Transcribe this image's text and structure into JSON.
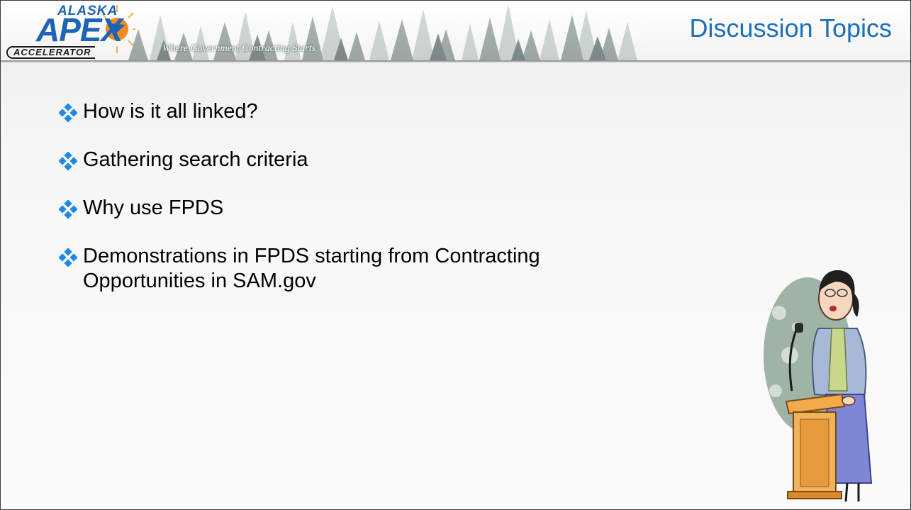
{
  "header": {
    "logo": {
      "top": "ALASKA",
      "main": "APEX",
      "bottom": "ACCELERATOR"
    },
    "tagline": "Where Government Contracting Starts",
    "title": "Discussion Topics"
  },
  "bullets": [
    {
      "text": "How is it all linked?"
    },
    {
      "text": "Gathering search criteria"
    },
    {
      "text": "Why use FPDS"
    },
    {
      "text": "Demonstrations in FPDS starting from Contracting Opportunities in SAM.gov"
    }
  ],
  "colors": {
    "title": "#1f6fb8",
    "bullet_icon": "#1e88e5",
    "logo_blue": "#1d63b6",
    "logo_sun": "#f28c1e"
  },
  "icons": {
    "bullet": "four-diamond-bullet-icon",
    "illustration": "woman-speaking-at-podium-illustration"
  }
}
